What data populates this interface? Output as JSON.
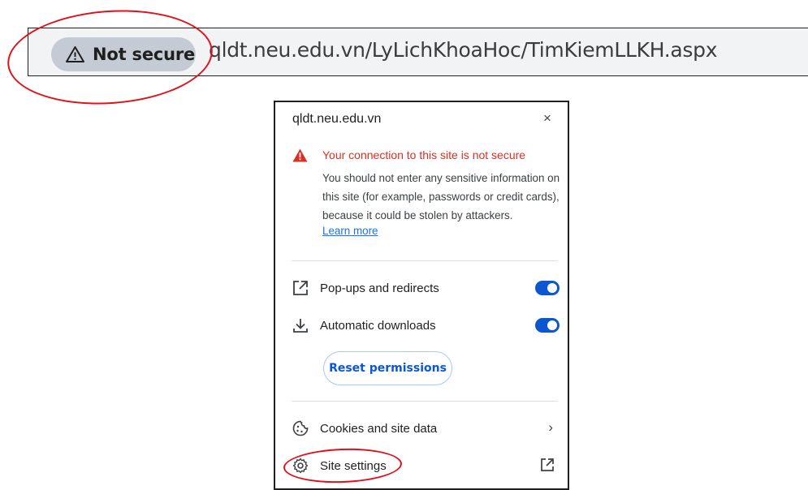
{
  "address_bar": {
    "security_chip": {
      "icon": "warning-triangle-icon",
      "label": "Not secure"
    },
    "url": "qldt.neu.edu.vn/LyLichKhoaHoc/TimKiemLLKH.aspx"
  },
  "popup": {
    "host": "qldt.neu.edu.vn",
    "close_label": "×",
    "warning": {
      "icon": "warning-triangle-icon",
      "title": "Your connection to this site is not secure",
      "body": "You should not enter any sensitive information on this site (for example, passwords or credit cards), because it could be stolen by attackers.",
      "learn_more": "Learn more"
    },
    "permissions": [
      {
        "icon": "open-in-new-icon",
        "label": "Pop-ups and redirects",
        "enabled": true
      },
      {
        "icon": "download-icon",
        "label": "Automatic downloads",
        "enabled": true
      }
    ],
    "reset_button": "Reset permissions",
    "menu": [
      {
        "icon": "cookie-icon",
        "label": "Cookies and site data",
        "trailing": "›"
      },
      {
        "icon": "gear-icon",
        "label": "Site settings",
        "trailing_icon": "open-in-new-icon"
      }
    ]
  },
  "colors": {
    "highlight_ring": "#e0111b",
    "warning_red": "#d93025",
    "toggle_blue": "#0b57d0",
    "link_blue": "#1a73e8"
  }
}
